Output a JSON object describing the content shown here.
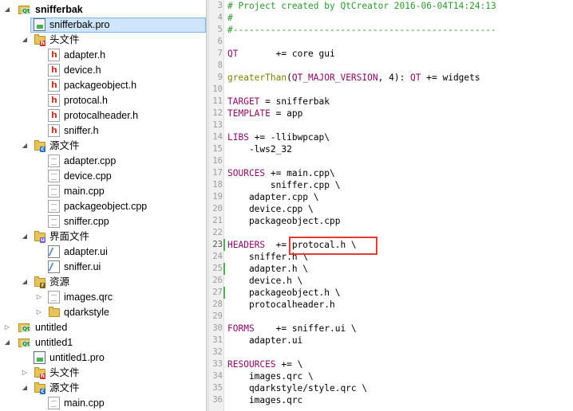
{
  "project_tree": [
    {
      "label": "snifferbak",
      "depth": 0,
      "arrow": "down",
      "icon": "qt-project-icon",
      "bold": true
    },
    {
      "label": "snifferbak.pro",
      "depth": 1,
      "icon": "pro-file-icon",
      "selected": true
    },
    {
      "label": "头文件",
      "depth": 1,
      "arrow": "down",
      "icon": "headers-folder-icon"
    },
    {
      "label": "adapter.h",
      "depth": 2,
      "icon": "header-file-icon"
    },
    {
      "label": "device.h",
      "depth": 2,
      "icon": "header-file-icon"
    },
    {
      "label": "packageobject.h",
      "depth": 2,
      "icon": "header-file-icon"
    },
    {
      "label": "protocal.h",
      "depth": 2,
      "icon": "header-file-icon"
    },
    {
      "label": "protocalheader.h",
      "depth": 2,
      "icon": "header-file-icon"
    },
    {
      "label": "sniffer.h",
      "depth": 2,
      "icon": "header-file-icon"
    },
    {
      "label": "源文件",
      "depth": 1,
      "arrow": "down",
      "icon": "sources-folder-icon"
    },
    {
      "label": "adapter.cpp",
      "depth": 2,
      "icon": "cpp-file-icon"
    },
    {
      "label": "device.cpp",
      "depth": 2,
      "icon": "cpp-file-icon"
    },
    {
      "label": "main.cpp",
      "depth": 2,
      "icon": "cpp-file-icon"
    },
    {
      "label": "packageobject.cpp",
      "depth": 2,
      "icon": "cpp-file-icon"
    },
    {
      "label": "sniffer.cpp",
      "depth": 2,
      "icon": "cpp-file-icon"
    },
    {
      "label": "界面文件",
      "depth": 1,
      "arrow": "down",
      "icon": "forms-folder-icon"
    },
    {
      "label": "adapter.ui",
      "depth": 2,
      "icon": "ui-file-icon"
    },
    {
      "label": "sniffer.ui",
      "depth": 2,
      "icon": "ui-file-icon"
    },
    {
      "label": "资源",
      "depth": 1,
      "arrow": "down",
      "icon": "resources-folder-icon"
    },
    {
      "label": "images.qrc",
      "depth": 2,
      "arrow": "right",
      "icon": "qrc-file-icon"
    },
    {
      "label": "qdarkstyle",
      "depth": 2,
      "arrow": "right",
      "icon": "folder-icon"
    },
    {
      "label": "untitled",
      "depth": 0,
      "arrow": "right",
      "icon": "qt-project-icon"
    },
    {
      "label": "untitled1",
      "depth": 0,
      "arrow": "down",
      "icon": "qt-project-icon"
    },
    {
      "label": "untitled1.pro",
      "depth": 1,
      "icon": "pro-file-icon"
    },
    {
      "label": "头文件",
      "depth": 1,
      "arrow": "right",
      "icon": "headers-folder-icon"
    },
    {
      "label": "源文件",
      "depth": 1,
      "arrow": "down",
      "icon": "sources-folder-icon"
    },
    {
      "label": "main.cpp",
      "depth": 2,
      "icon": "cpp-file-icon"
    }
  ],
  "editor": {
    "lines": [
      {
        "n": "3",
        "text": "# Project created by QtCreator 2016-06-04T14:24:13"
      },
      {
        "n": "4",
        "text": "#"
      },
      {
        "n": "5",
        "text": "#-------------------------------------------------"
      },
      {
        "n": "6",
        "text": ""
      },
      {
        "n": "7",
        "text": "QT       += core gui"
      },
      {
        "n": "8",
        "text": ""
      },
      {
        "n": "9",
        "text": "greaterThan(QT_MAJOR_VERSION, 4): QT += widgets"
      },
      {
        "n": "10",
        "text": ""
      },
      {
        "n": "11",
        "text": "TARGET = snifferbak"
      },
      {
        "n": "12",
        "text": "TEMPLATE = app"
      },
      {
        "n": "13",
        "text": ""
      },
      {
        "n": "14",
        "text": "LIBS += -llibwpcap\\"
      },
      {
        "n": "15",
        "text": "    -lws2_32"
      },
      {
        "n": "16",
        "text": ""
      },
      {
        "n": "17",
        "text": "SOURCES += main.cpp\\"
      },
      {
        "n": "18",
        "text": "        sniffer.cpp \\"
      },
      {
        "n": "19",
        "text": "    adapter.cpp \\"
      },
      {
        "n": "20",
        "text": "    device.cpp \\"
      },
      {
        "n": "21",
        "text": "    packageobject.cpp"
      },
      {
        "n": "22",
        "text": ""
      },
      {
        "n": "23",
        "text": "HEADERS  += protocal.h \\"
      },
      {
        "n": "24",
        "text": "    sniffer.h \\"
      },
      {
        "n": "25",
        "text": "    adapter.h \\"
      },
      {
        "n": "26",
        "text": "    device.h \\"
      },
      {
        "n": "27",
        "text": "    packageobject.h \\"
      },
      {
        "n": "28",
        "text": "    protocalheader.h"
      },
      {
        "n": "29",
        "text": ""
      },
      {
        "n": "30",
        "text": "FORMS    += sniffer.ui \\"
      },
      {
        "n": "31",
        "text": "    adapter.ui"
      },
      {
        "n": "32",
        "text": ""
      },
      {
        "n": "33",
        "text": "RESOURCES += \\"
      },
      {
        "n": "34",
        "text": "    images.qrc \\"
      },
      {
        "n": "35",
        "text": "    qdarkstyle/style.qrc \\"
      },
      {
        "n": "36",
        "text": "    images.qrc"
      }
    ],
    "highlighted_token": "protocal.h \\",
    "colors": {
      "comment": "#2e9a2e",
      "variable": "#8a0a6a",
      "function": "#808000",
      "highlight_box": "#e53935"
    }
  }
}
